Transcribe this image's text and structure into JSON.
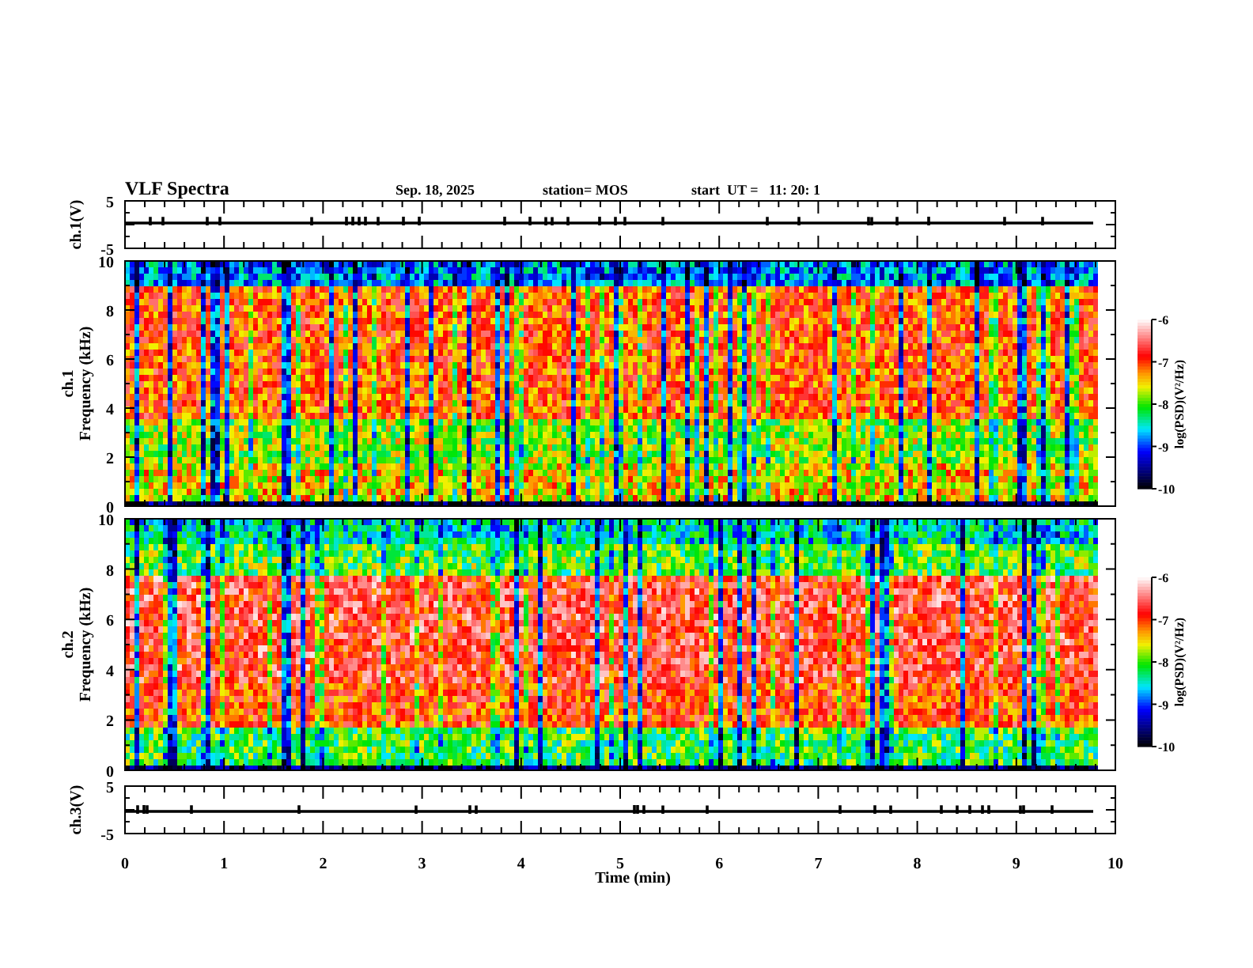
{
  "header": {
    "title": "VLF Spectra",
    "date": "Sep. 18, 2025",
    "station": "station= MOS",
    "start": "start  UT =   11: 20: 1"
  },
  "panels": [
    {
      "kind": "waveform",
      "label": "ch.1(V)",
      "yticks": [
        "5",
        "-5"
      ]
    },
    {
      "kind": "spectrogram",
      "channel": "ch.1",
      "ylabel": "Frequency (kHz)",
      "yticks": [
        "10",
        "8",
        "6",
        "4",
        "2",
        "0"
      ],
      "colorbar": {
        "label": "log(PSD)(V²/Hz)",
        "ticks": [
          "-6",
          "-7",
          "-8",
          "-9",
          "-10"
        ]
      }
    },
    {
      "kind": "spectrogram",
      "channel": "ch.2",
      "ylabel": "Frequency (kHz)",
      "yticks": [
        "10",
        "8",
        "6",
        "4",
        "2",
        "0"
      ],
      "colorbar": {
        "label": "log(PSD)(V²/Hz)",
        "ticks": [
          "-6",
          "-7",
          "-8",
          "-9",
          "-10"
        ]
      }
    },
    {
      "kind": "waveform",
      "label": "ch.3(V)",
      "yticks": [
        "5",
        "-5"
      ]
    }
  ],
  "xaxis": {
    "label": "Time (min)",
    "ticks": [
      "0",
      "1",
      "2",
      "3",
      "4",
      "5",
      "6",
      "7",
      "8",
      "9",
      "10"
    ]
  }
}
